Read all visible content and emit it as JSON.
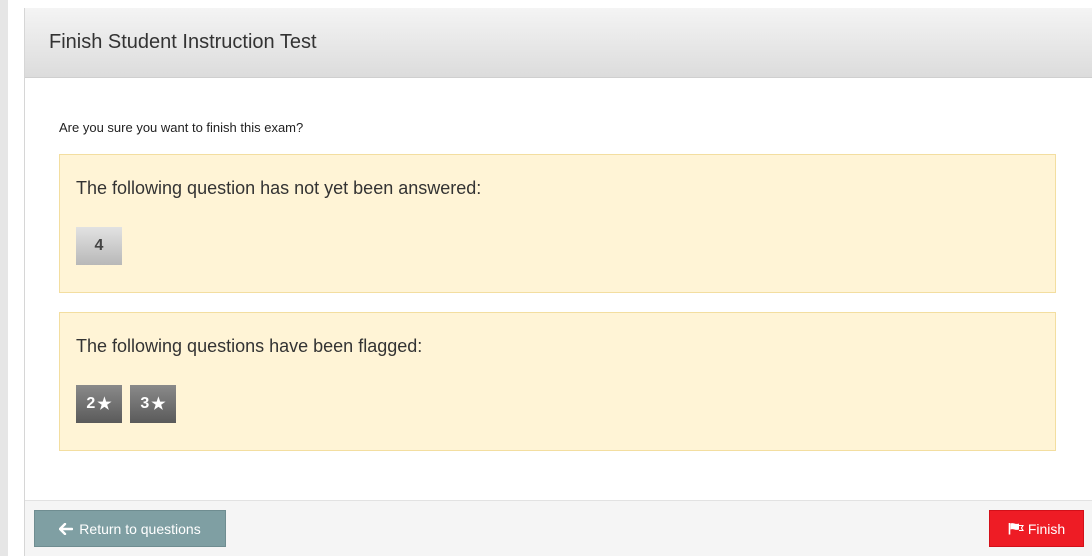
{
  "dialog": {
    "title": "Finish Student Instruction Test",
    "prompt": "Are you sure you want to finish this exam?"
  },
  "unanswered": {
    "heading": "The following question has not yet been answered:",
    "questions": [
      "4"
    ]
  },
  "flagged": {
    "heading": "The following questions have been flagged:",
    "questions": [
      "2",
      "3"
    ],
    "icon": "star-icon"
  },
  "footer": {
    "return_label": "Return to questions",
    "return_icon": "arrow-left-icon",
    "finish_label": "Finish",
    "finish_icon": "flag-icon"
  },
  "colors": {
    "panel_bg": "#fff4d6",
    "finish_button": "#ee1c25",
    "return_button": "#7f9fa3"
  }
}
